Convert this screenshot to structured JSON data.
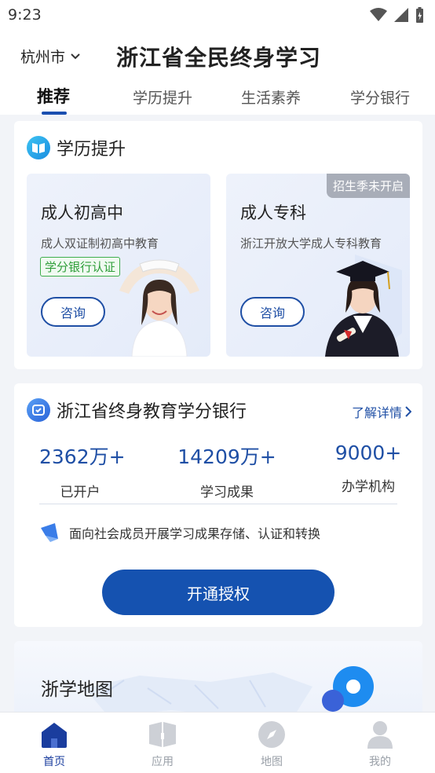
{
  "status_bar": {
    "time": "9:23"
  },
  "header": {
    "city": "杭州市",
    "title": "浙江省全民终身学习",
    "tabs": [
      {
        "label": "推荐"
      },
      {
        "label": "学历提升"
      },
      {
        "label": "生活素养"
      },
      {
        "label": "学分银行"
      }
    ]
  },
  "education_section": {
    "title": "学历提升",
    "programs": [
      {
        "title": "成人初高中",
        "desc": "成人双证制初高中教育",
        "badge": "学分银行认证",
        "button": "咨询"
      },
      {
        "title": "成人专科",
        "desc": "浙江开放大学成人专科教育",
        "tag": "招生季未开启",
        "button": "咨询"
      }
    ]
  },
  "credit_bank": {
    "title": "浙江省终身教育学分银行",
    "more": "了解详情",
    "stats": [
      {
        "value": "2362万+",
        "label": "已开户"
      },
      {
        "value": "14209万+",
        "label": "学习成果"
      },
      {
        "value": "9000+",
        "label": "办学机构"
      }
    ],
    "feature": "面向社会成员开展学习成果存储、认证和转换",
    "cta": "开通授权"
  },
  "map_section": {
    "title": "浙学地图"
  },
  "bottom_nav": [
    {
      "label": "首页",
      "icon": "home-icon"
    },
    {
      "label": "应用",
      "icon": "apps-icon"
    },
    {
      "label": "地图",
      "icon": "compass-icon"
    },
    {
      "label": "我的",
      "icon": "profile-icon"
    }
  ],
  "colors": {
    "accent": "#1552b0",
    "active_nav": "#1a3d9e",
    "badge_green": "#2f9e3a"
  }
}
